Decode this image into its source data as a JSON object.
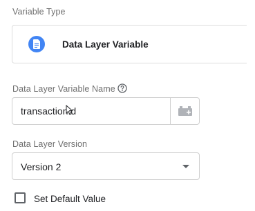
{
  "variable_type": {
    "label": "Variable Type",
    "selected_type": "Data Layer Variable",
    "icon": "document-icon",
    "icon_color": "#4285f4"
  },
  "name_field": {
    "label": "Data Layer Variable Name",
    "help_icon": "help-circle-icon",
    "value": "transactionId",
    "picker_icon": "variable-picker-icon"
  },
  "version_field": {
    "label": "Data Layer Version",
    "selected": "Version 2"
  },
  "default_value": {
    "label": "Set Default Value",
    "checked": false
  }
}
